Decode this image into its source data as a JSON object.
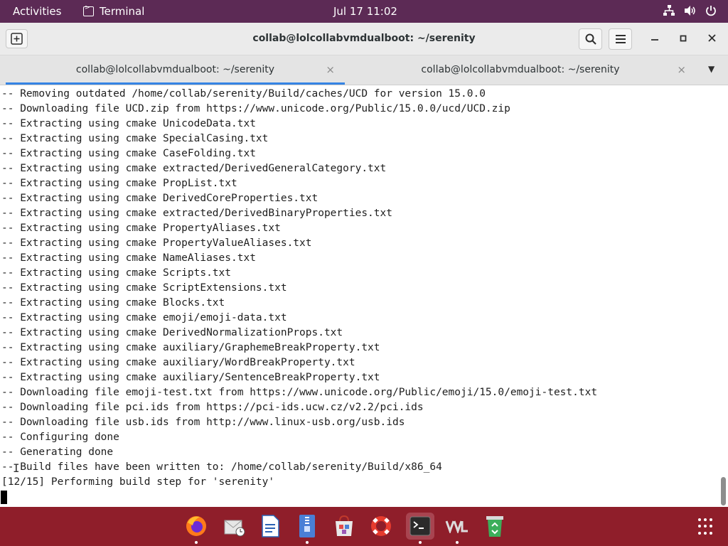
{
  "topbar": {
    "activities": "Activities",
    "app_name": "Terminal",
    "clock": "Jul 17  11:02"
  },
  "window": {
    "title": "collab@lolcollabvmdualboot: ~/serenity",
    "new_tab_symbol": "+",
    "search_symbol": "⚲",
    "menu_symbol": "☰",
    "minimize_symbol": "–",
    "maximize_symbol": "▫",
    "close_symbol": "✕"
  },
  "tabs": [
    {
      "label": "collab@lolcollabvmdualboot: ~/serenity",
      "close": "×",
      "active": true
    },
    {
      "label": "collab@lolcollabvmdualboot: ~/serenity",
      "close": "×",
      "active": false
    }
  ],
  "tab_menu_symbol": "▼",
  "terminal": {
    "lines": [
      "-- Removing outdated /home/collab/serenity/Build/caches/UCD for version 15.0.0",
      "-- Downloading file UCD.zip from https://www.unicode.org/Public/15.0.0/ucd/UCD.zip",
      "-- Extracting using cmake UnicodeData.txt",
      "-- Extracting using cmake SpecialCasing.txt",
      "-- Extracting using cmake CaseFolding.txt",
      "-- Extracting using cmake extracted/DerivedGeneralCategory.txt",
      "-- Extracting using cmake PropList.txt",
      "-- Extracting using cmake DerivedCoreProperties.txt",
      "-- Extracting using cmake extracted/DerivedBinaryProperties.txt",
      "-- Extracting using cmake PropertyAliases.txt",
      "-- Extracting using cmake PropertyValueAliases.txt",
      "-- Extracting using cmake NameAliases.txt",
      "-- Extracting using cmake Scripts.txt",
      "-- Extracting using cmake ScriptExtensions.txt",
      "-- Extracting using cmake Blocks.txt",
      "-- Extracting using cmake emoji/emoji-data.txt",
      "-- Extracting using cmake DerivedNormalizationProps.txt",
      "-- Extracting using cmake auxiliary/GraphemeBreakProperty.txt",
      "-- Extracting using cmake auxiliary/WordBreakProperty.txt",
      "-- Extracting using cmake auxiliary/SentenceBreakProperty.txt",
      "-- Downloading file emoji-test.txt from https://www.unicode.org/Public/emoji/15.0/emoji-test.txt",
      "-- Downloading file pci.ids from https://pci-ids.ucw.cz/v2.2/pci.ids",
      "-- Downloading file usb.ids from http://www.linux-usb.org/usb.ids",
      "-- Configuring done",
      "-- Generating done",
      "-- Build files have been written to: /home/collab/serenity/Build/x86_64",
      "[12/15] Performing build step for 'serenity'"
    ]
  },
  "dock": {
    "items": [
      {
        "name": "firefox-icon",
        "active": false,
        "running": true
      },
      {
        "name": "evolution-mail-icon",
        "active": false,
        "running": false
      },
      {
        "name": "libreoffice-writer-icon",
        "active": false,
        "running": false
      },
      {
        "name": "files-icon",
        "active": false,
        "running": true
      },
      {
        "name": "software-store-icon",
        "active": false,
        "running": false
      },
      {
        "name": "help-icon",
        "active": false,
        "running": false
      },
      {
        "name": "terminal-icon",
        "active": true,
        "running": true
      },
      {
        "name": "virtual-machine-icon",
        "active": false,
        "running": true
      },
      {
        "name": "trash-icon",
        "active": false,
        "running": false
      }
    ]
  },
  "colors": {
    "topbar": "#5c2a55",
    "dock": "#8f1e2a",
    "tab_accent": "#3584e4"
  }
}
